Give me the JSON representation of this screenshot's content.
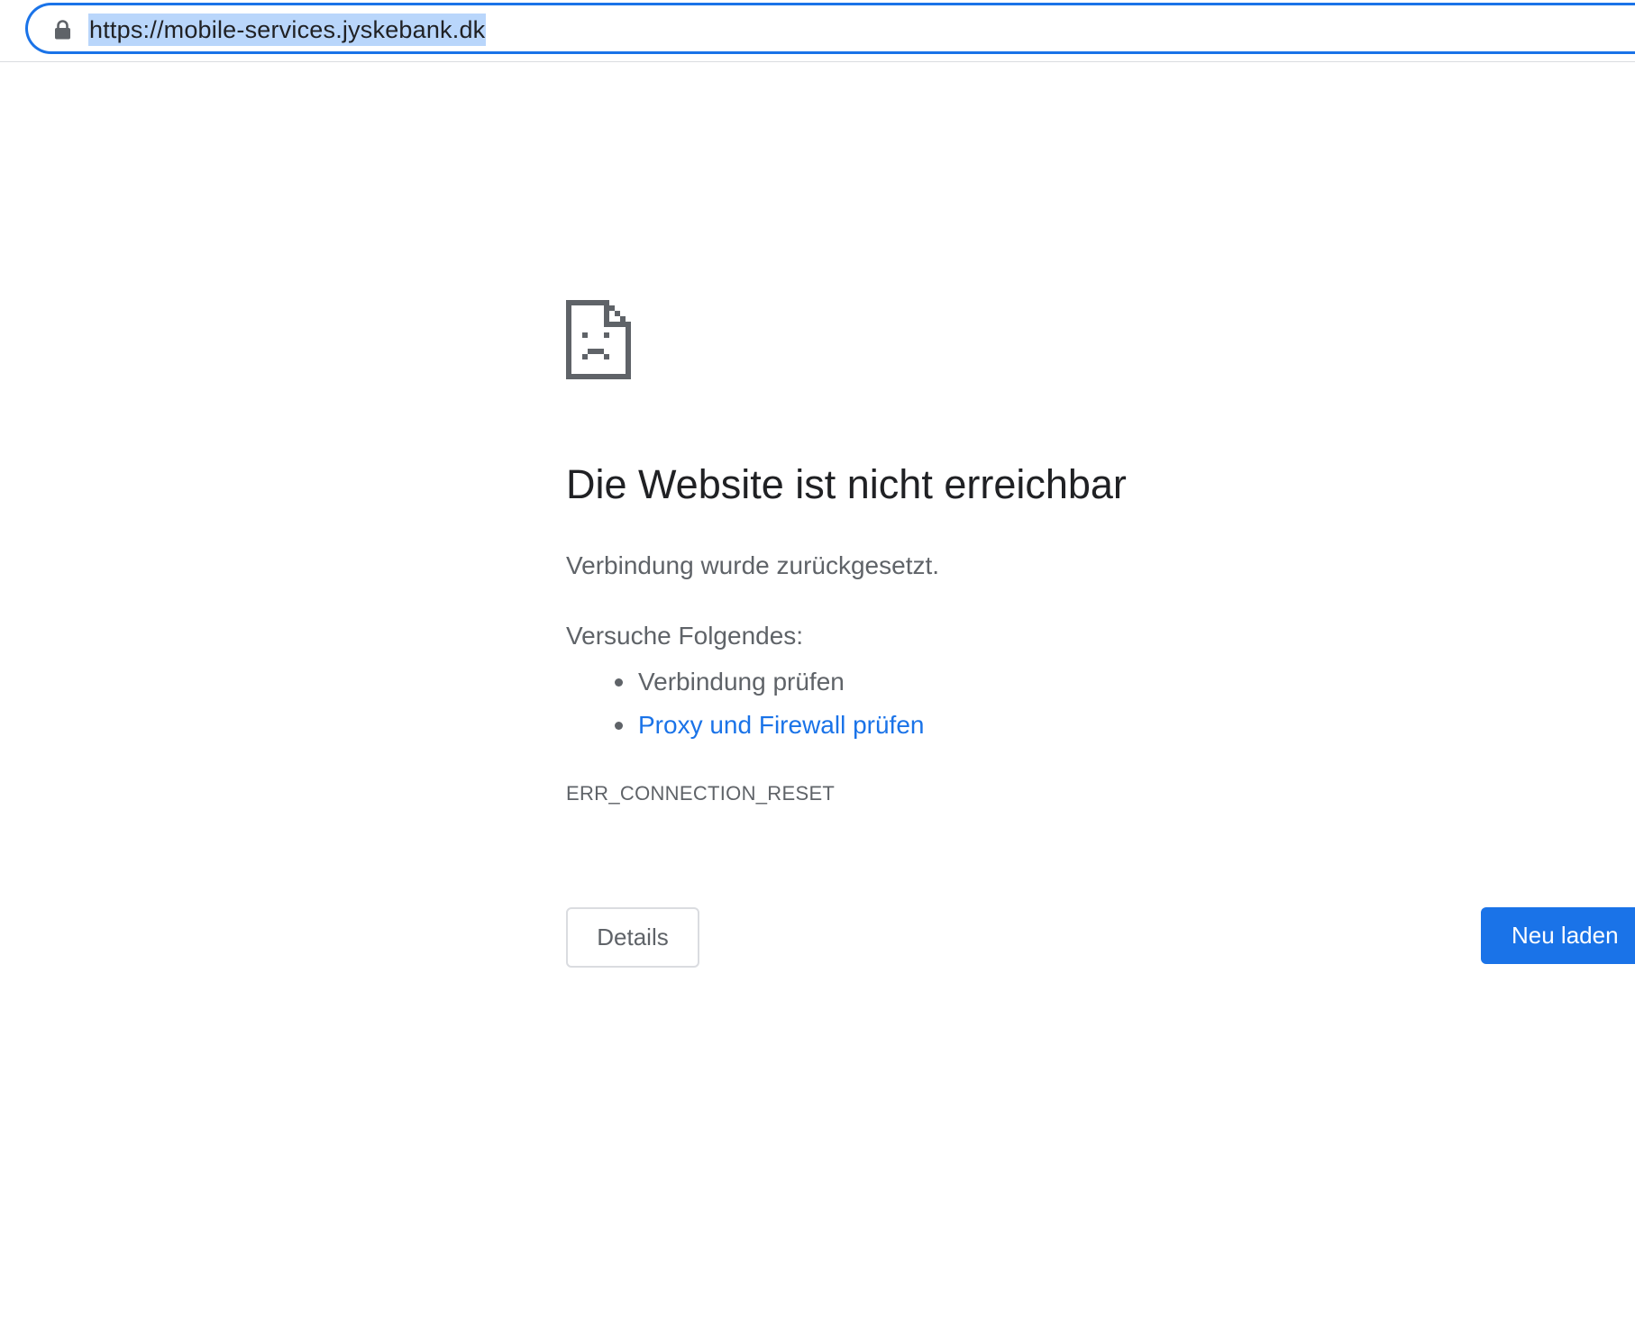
{
  "address_bar": {
    "url": "https://mobile-services.jyskebank.dk",
    "lock_icon": "lock-icon"
  },
  "error_page": {
    "icon": "sad-document-icon",
    "title": "Die Website ist nicht erreichbar",
    "message": "Verbindung wurde zurückgesetzt.",
    "suggestions_heading": "Versuche Folgendes:",
    "suggestions": [
      {
        "label": "Verbindung prüfen",
        "is_link": false
      },
      {
        "label": "Proxy und Firewall prüfen",
        "is_link": true
      }
    ],
    "error_code": "ERR_CONNECTION_RESET",
    "details_button": "Details",
    "reload_button": "Neu laden"
  },
  "colors": {
    "accent": "#1a73e8",
    "text_primary": "#202124",
    "text_secondary": "#5f6368",
    "url_selection": "#b9d6fb"
  }
}
